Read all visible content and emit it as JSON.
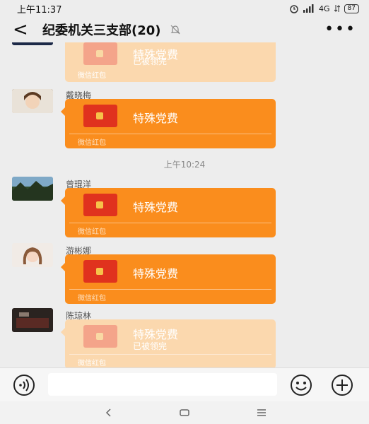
{
  "status_bar": {
    "time": "上午11:37",
    "network": "4G",
    "battery": "87"
  },
  "header": {
    "title": "纪委机关三支部(20)"
  },
  "messages": [
    {
      "sender": "",
      "title": "特殊党费",
      "status": "已被领完",
      "footer": "微信红包"
    },
    {
      "sender": "戴晓梅",
      "title": "特殊党费",
      "status": "",
      "footer": "微信红包"
    },
    {
      "sender": "曾琨洋",
      "title": "特殊党费",
      "status": "",
      "footer": "微信红包"
    },
    {
      "sender": "游彬娜",
      "title": "特殊党费",
      "status": "",
      "footer": "微信红包"
    },
    {
      "sender": "陈琼林",
      "title": "特殊党费",
      "status": "已被领完",
      "footer": "微信红包"
    }
  ],
  "timestamp": "上午10:24",
  "input": {
    "placeholder": ""
  },
  "colors": {
    "packet": "#fa8d1d",
    "packet_opened": "#fbd8ae",
    "background": "#ededed"
  },
  "icons": {
    "back": "back-icon",
    "mute": "mute-icon",
    "more": "more-icon",
    "voice": "voice-icon",
    "emoji": "emoji-icon",
    "plus": "plus-icon"
  }
}
